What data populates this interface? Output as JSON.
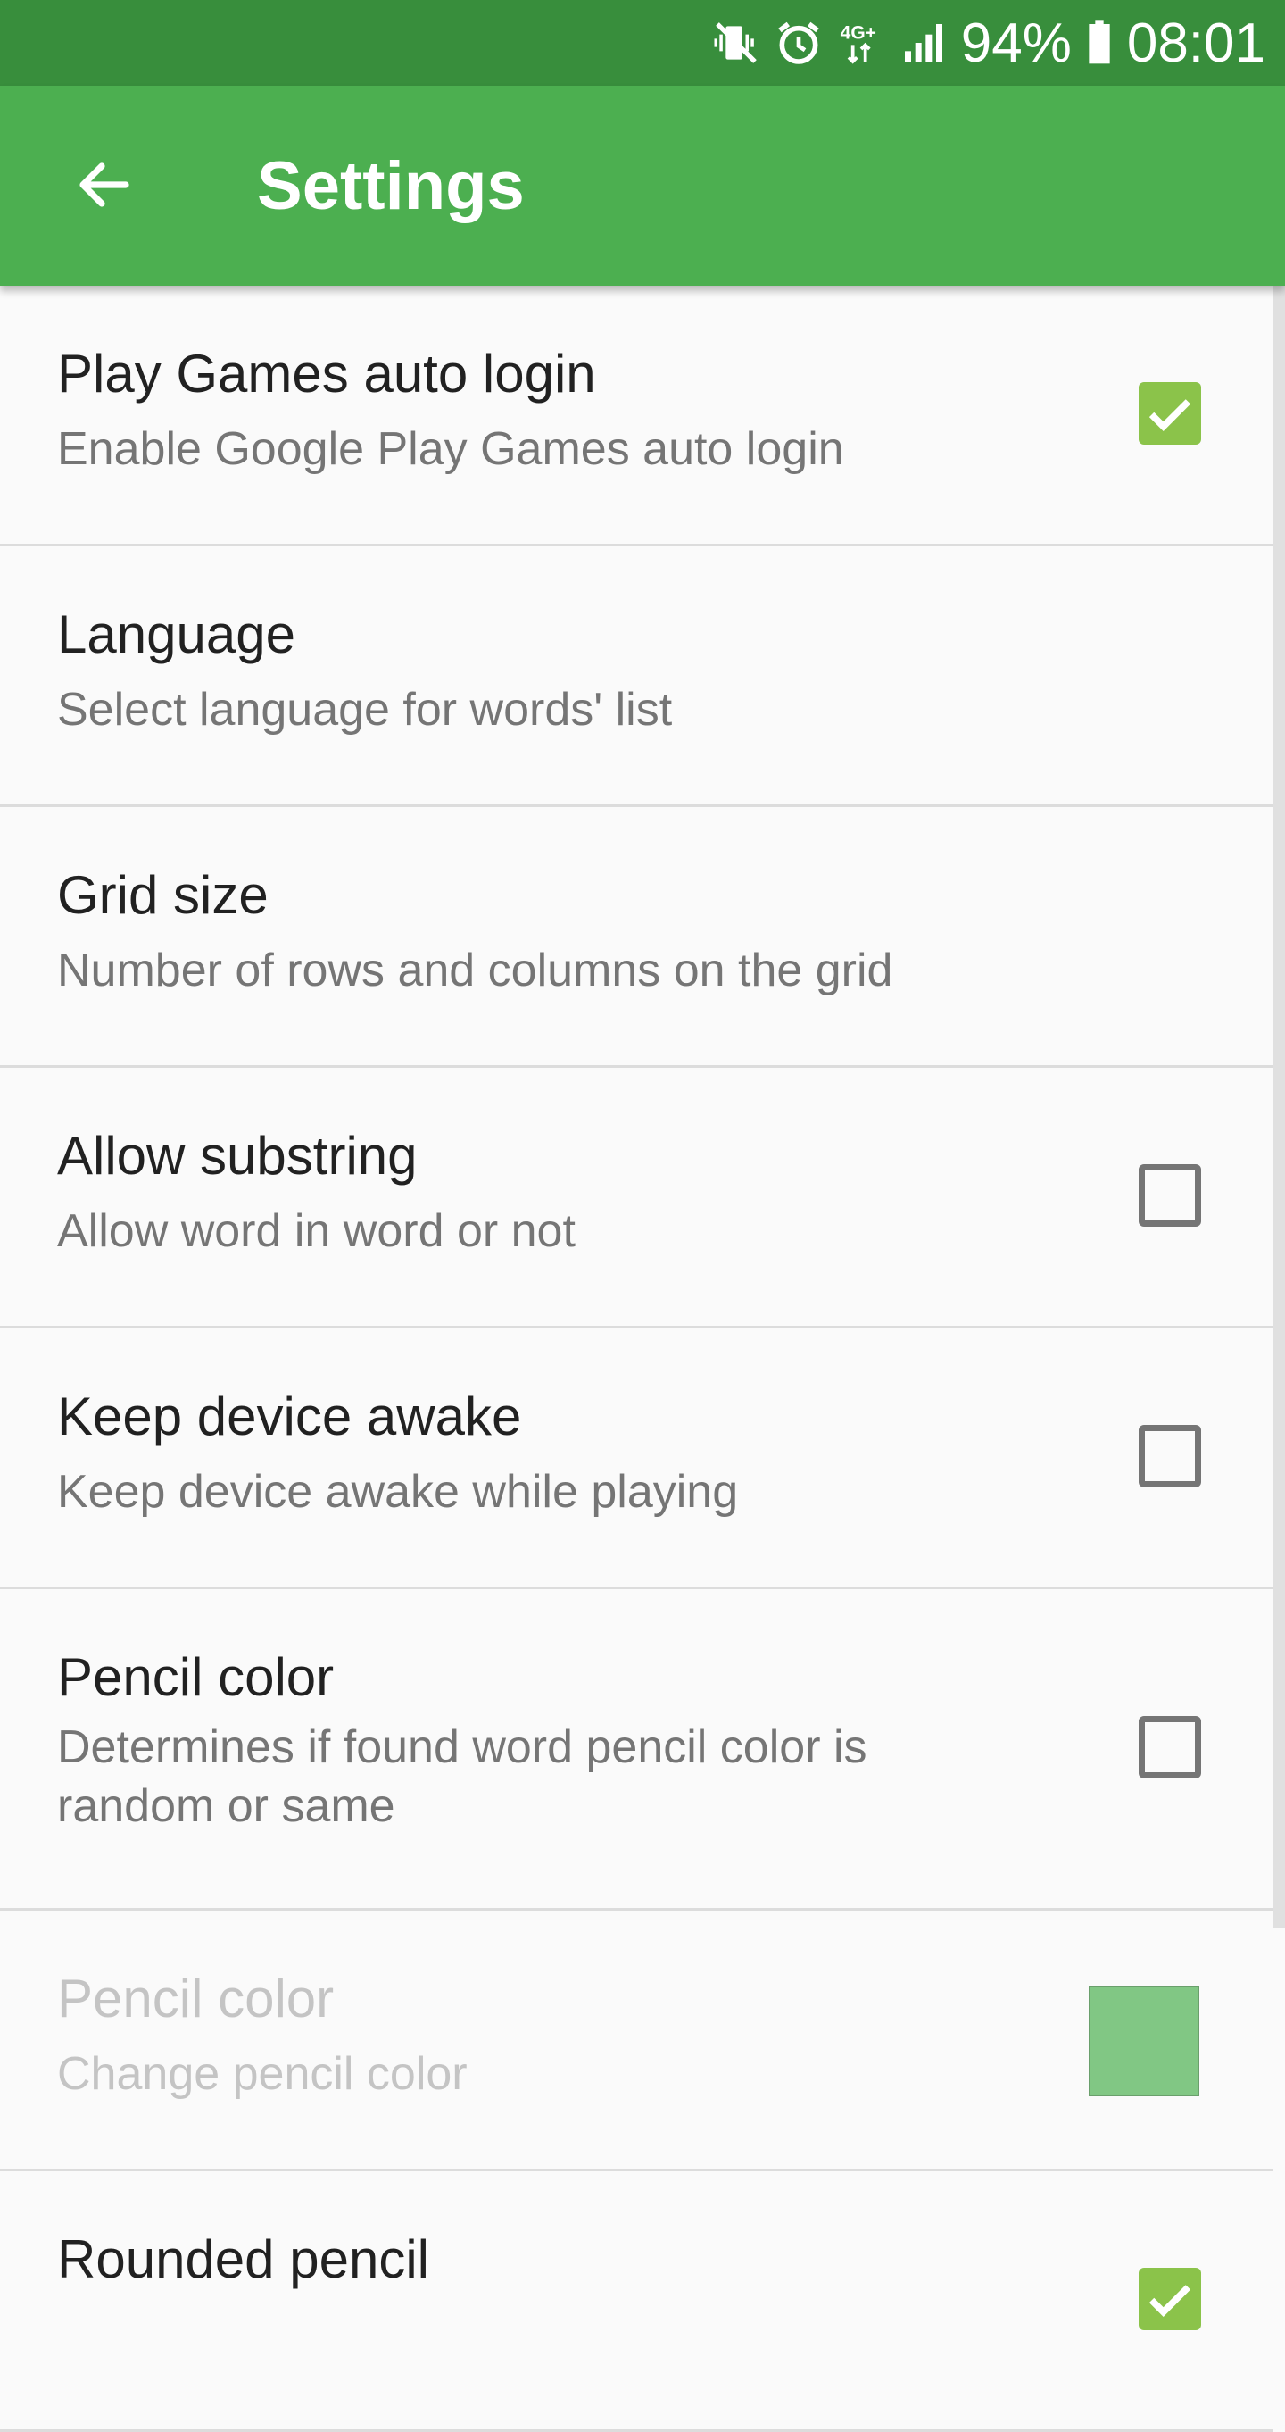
{
  "status_bar": {
    "battery_percent": "94%",
    "time": "08:01",
    "network_label": "4G+",
    "icons": [
      "vibrate-icon",
      "alarm-icon",
      "network-4g-icon",
      "signal-icon",
      "battery-icon"
    ]
  },
  "app_bar": {
    "title": "Settings",
    "back_icon": "arrow-left-icon",
    "color": "#4caf50",
    "status_color": "#388e3c"
  },
  "settings": [
    {
      "title": "Play Games auto login",
      "summary": "Enable Google Play Games auto login",
      "control": "checkbox",
      "checked": true
    },
    {
      "title": "Language",
      "summary": "Select language for words' list",
      "control": "none"
    },
    {
      "title": "Grid size",
      "summary": "Number of rows and columns on the grid",
      "control": "none"
    },
    {
      "title": "Allow substring",
      "summary": "Allow word in word or not",
      "control": "checkbox",
      "checked": false
    },
    {
      "title": "Keep device awake",
      "summary": "Keep device awake while playing",
      "control": "checkbox",
      "checked": false
    },
    {
      "title": "Pencil color",
      "summary": "Determines if found word pencil color is random or same",
      "control": "checkbox",
      "checked": false
    },
    {
      "title": "Pencil color",
      "summary": "Change pencil color",
      "control": "color-swatch",
      "color": "#81c784",
      "disabled": true
    },
    {
      "title": "Rounded pencil",
      "summary": "",
      "control": "checkbox",
      "checked": true
    }
  ]
}
